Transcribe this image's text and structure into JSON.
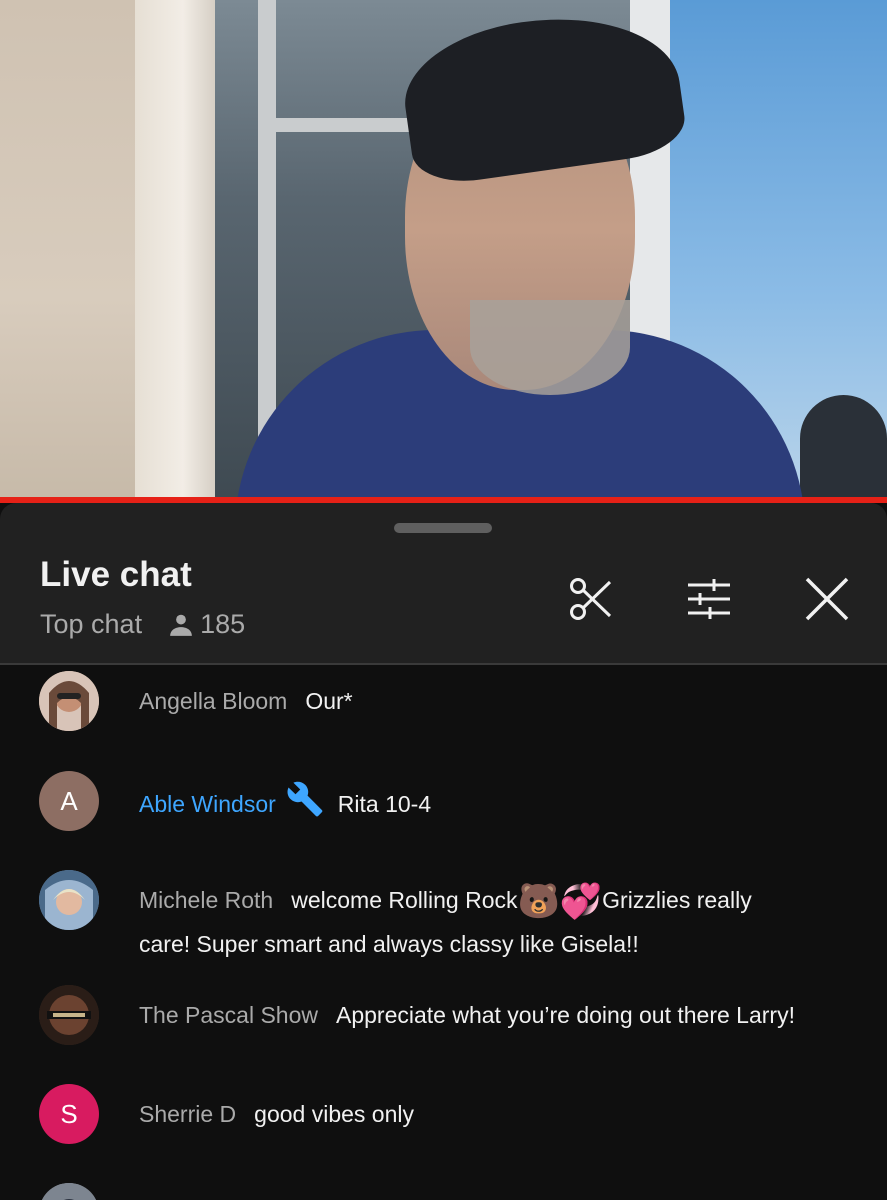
{
  "chat": {
    "title": "Live chat",
    "mode": "Top chat",
    "viewer_count": "185"
  },
  "messages": [
    {
      "author": "Angella Bloom",
      "text": "Our*",
      "avatar_type": "photo",
      "avatar_color": "#c9a08a"
    },
    {
      "author": "Able Windsor",
      "text": "Rita 10-4",
      "avatar_type": "letter",
      "avatar_letter": "A",
      "avatar_color": "#8d6e63",
      "badge": "wrench-icon",
      "author_color": "#3ea6ff"
    },
    {
      "author": "Michele Roth",
      "text_a": "welcome Rolling Rock",
      "emoji_1": "🐻",
      "emoji_2": "💞",
      "text_b": "Grizzlies really",
      "text_c": "care! Super smart and always classy like Gisela!!",
      "avatar_type": "photo",
      "avatar_color": "#6d8fb0"
    },
    {
      "author": "The Pascal Show",
      "text": "Appreciate what you’re doing out there Larry!",
      "avatar_type": "photo",
      "avatar_color": "#3a2a22"
    },
    {
      "author": "Sherrie D",
      "text": "good vibes only",
      "avatar_type": "letter",
      "avatar_letter": "S",
      "avatar_color": "#d81b60"
    }
  ],
  "colors": {
    "progress": "#e62117",
    "header_bg": "#212121",
    "panel_bg": "#0f0f0f",
    "moderator_blue": "#3ea6ff"
  }
}
